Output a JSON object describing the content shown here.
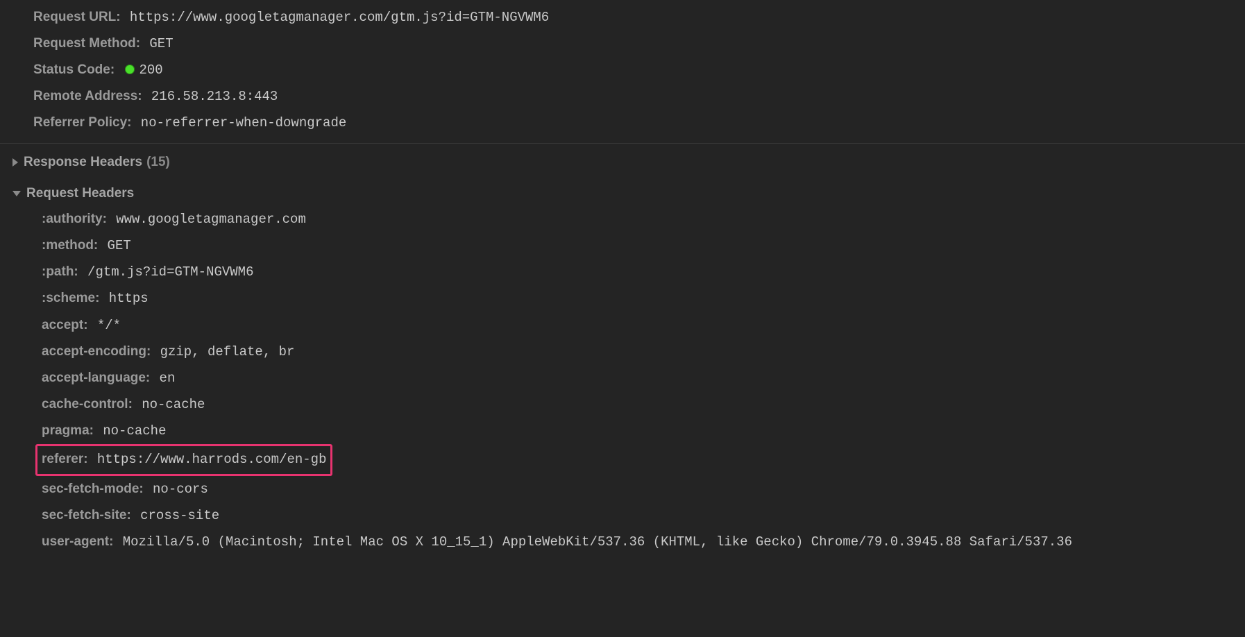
{
  "general": {
    "request_url": {
      "label": "Request URL:",
      "value": "https://www.googletagmanager.com/gtm.js?id=GTM-NGVWM6"
    },
    "request_method": {
      "label": "Request Method:",
      "value": "GET"
    },
    "status_code": {
      "label": "Status Code:",
      "value": "200"
    },
    "remote_address": {
      "label": "Remote Address:",
      "value": "216.58.213.8:443"
    },
    "referrer_policy": {
      "label": "Referrer Policy:",
      "value": "no-referrer-when-downgrade"
    }
  },
  "response_headers": {
    "title": "Response Headers",
    "count": "(15)"
  },
  "request_headers": {
    "title": "Request Headers"
  },
  "headers": {
    "authority": {
      "label": ":authority:",
      "value": "www.googletagmanager.com"
    },
    "method": {
      "label": ":method:",
      "value": "GET"
    },
    "path": {
      "label": ":path:",
      "value": "/gtm.js?id=GTM-NGVWM6"
    },
    "scheme": {
      "label": ":scheme:",
      "value": "https"
    },
    "accept": {
      "label": "accept:",
      "value": "*/*"
    },
    "accept_encoding": {
      "label": "accept-encoding:",
      "value": "gzip, deflate, br"
    },
    "accept_language": {
      "label": "accept-language:",
      "value": "en"
    },
    "cache_control": {
      "label": "cache-control:",
      "value": "no-cache"
    },
    "pragma": {
      "label": "pragma:",
      "value": "no-cache"
    },
    "referer": {
      "label": "referer:",
      "value": "https://www.harrods.com/en-gb"
    },
    "sec_fetch_mode": {
      "label": "sec-fetch-mode:",
      "value": "no-cors"
    },
    "sec_fetch_site": {
      "label": "sec-fetch-site:",
      "value": "cross-site"
    },
    "user_agent": {
      "label": "user-agent:",
      "value": "Mozilla/5.0 (Macintosh; Intel Mac OS X 10_15_1) AppleWebKit/537.36 (KHTML, like Gecko) Chrome/79.0.3945.88 Safari/537.36"
    }
  }
}
